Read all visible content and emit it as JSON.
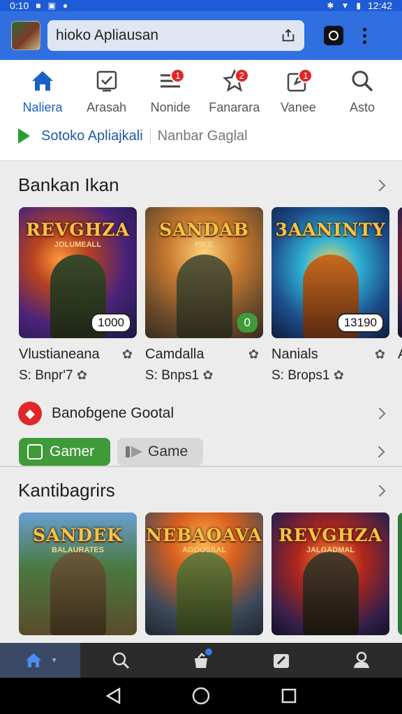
{
  "status_bar": {
    "time_left": "0:10",
    "time_right": "12:42"
  },
  "header": {
    "search_text": "hioko Apliausan"
  },
  "tabs": [
    {
      "label": "Naliera",
      "icon": "home-icon",
      "active": true,
      "badge": ""
    },
    {
      "label": "Arasah",
      "icon": "inbox-check-icon",
      "active": false,
      "badge": ""
    },
    {
      "label": "Nonide",
      "icon": "list-icon",
      "active": false,
      "badge": "1"
    },
    {
      "label": "Fanarara",
      "icon": "star-icon",
      "active": false,
      "badge": "2"
    },
    {
      "label": "Vanee",
      "icon": "edit-icon",
      "active": false,
      "badge": "1"
    },
    {
      "label": "Asto",
      "icon": "search-icon",
      "active": false,
      "badge": ""
    }
  ],
  "subline": {
    "primary": "Sotoko Apliajkali",
    "secondary": "Nanbar Gaglal"
  },
  "section1": {
    "title": "Bankan Ikan",
    "cards": [
      {
        "logo": "REVGHZA",
        "logo_sub": "JOLUMEALL",
        "pill": "1000",
        "name": "Vlustianeana",
        "sub": "S: Bnpr'7"
      },
      {
        "logo": "SANDAB",
        "logo_sub": "PIKE",
        "pill": "0",
        "name": "Camdalla",
        "sub": "S: Bnps1"
      },
      {
        "logo": "3AANINTY",
        "logo_sub": "",
        "pill": "13190",
        "name": "Nanials",
        "sub": "S: Brops1"
      }
    ],
    "partial_card_name": "A"
  },
  "promo": {
    "text": "Banoɓgene Gootal"
  },
  "chips": {
    "primary": "Gamer",
    "secondary": "Game"
  },
  "section2": {
    "title": "Kantibagrirs",
    "cards": [
      {
        "logo": "SANDEK",
        "logo_sub": "BALAURATES"
      },
      {
        "logo": "NEBAOAVA",
        "logo_sub": "AGOOSSAL"
      },
      {
        "logo": "REVGHZA",
        "logo_sub": "JALGADMAL"
      }
    ]
  },
  "bottom_nav": [
    {
      "icon": "home-icon",
      "active": true
    },
    {
      "icon": "search-icon",
      "active": false
    },
    {
      "icon": "bag-icon",
      "active": false
    },
    {
      "icon": "pen-icon",
      "active": false
    },
    {
      "icon": "person-icon",
      "active": false
    }
  ],
  "colors": {
    "brand": "#2f6fe0",
    "accent_green": "#3f9b3a",
    "badge_red": "#e02727"
  }
}
